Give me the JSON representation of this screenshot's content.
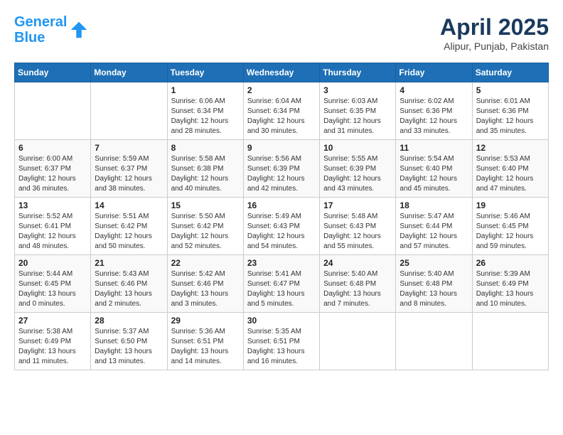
{
  "header": {
    "logo_line1": "General",
    "logo_line2": "Blue",
    "title": "April 2025",
    "subtitle": "Alipur, Punjab, Pakistan"
  },
  "weekdays": [
    "Sunday",
    "Monday",
    "Tuesday",
    "Wednesday",
    "Thursday",
    "Friday",
    "Saturday"
  ],
  "weeks": [
    [
      {
        "day": "",
        "info": ""
      },
      {
        "day": "",
        "info": ""
      },
      {
        "day": "1",
        "info": "Sunrise: 6:06 AM\nSunset: 6:34 PM\nDaylight: 12 hours\nand 28 minutes."
      },
      {
        "day": "2",
        "info": "Sunrise: 6:04 AM\nSunset: 6:34 PM\nDaylight: 12 hours\nand 30 minutes."
      },
      {
        "day": "3",
        "info": "Sunrise: 6:03 AM\nSunset: 6:35 PM\nDaylight: 12 hours\nand 31 minutes."
      },
      {
        "day": "4",
        "info": "Sunrise: 6:02 AM\nSunset: 6:36 PM\nDaylight: 12 hours\nand 33 minutes."
      },
      {
        "day": "5",
        "info": "Sunrise: 6:01 AM\nSunset: 6:36 PM\nDaylight: 12 hours\nand 35 minutes."
      }
    ],
    [
      {
        "day": "6",
        "info": "Sunrise: 6:00 AM\nSunset: 6:37 PM\nDaylight: 12 hours\nand 36 minutes."
      },
      {
        "day": "7",
        "info": "Sunrise: 5:59 AM\nSunset: 6:37 PM\nDaylight: 12 hours\nand 38 minutes."
      },
      {
        "day": "8",
        "info": "Sunrise: 5:58 AM\nSunset: 6:38 PM\nDaylight: 12 hours\nand 40 minutes."
      },
      {
        "day": "9",
        "info": "Sunrise: 5:56 AM\nSunset: 6:39 PM\nDaylight: 12 hours\nand 42 minutes."
      },
      {
        "day": "10",
        "info": "Sunrise: 5:55 AM\nSunset: 6:39 PM\nDaylight: 12 hours\nand 43 minutes."
      },
      {
        "day": "11",
        "info": "Sunrise: 5:54 AM\nSunset: 6:40 PM\nDaylight: 12 hours\nand 45 minutes."
      },
      {
        "day": "12",
        "info": "Sunrise: 5:53 AM\nSunset: 6:40 PM\nDaylight: 12 hours\nand 47 minutes."
      }
    ],
    [
      {
        "day": "13",
        "info": "Sunrise: 5:52 AM\nSunset: 6:41 PM\nDaylight: 12 hours\nand 48 minutes."
      },
      {
        "day": "14",
        "info": "Sunrise: 5:51 AM\nSunset: 6:42 PM\nDaylight: 12 hours\nand 50 minutes."
      },
      {
        "day": "15",
        "info": "Sunrise: 5:50 AM\nSunset: 6:42 PM\nDaylight: 12 hours\nand 52 minutes."
      },
      {
        "day": "16",
        "info": "Sunrise: 5:49 AM\nSunset: 6:43 PM\nDaylight: 12 hours\nand 54 minutes."
      },
      {
        "day": "17",
        "info": "Sunrise: 5:48 AM\nSunset: 6:43 PM\nDaylight: 12 hours\nand 55 minutes."
      },
      {
        "day": "18",
        "info": "Sunrise: 5:47 AM\nSunset: 6:44 PM\nDaylight: 12 hours\nand 57 minutes."
      },
      {
        "day": "19",
        "info": "Sunrise: 5:46 AM\nSunset: 6:45 PM\nDaylight: 12 hours\nand 59 minutes."
      }
    ],
    [
      {
        "day": "20",
        "info": "Sunrise: 5:44 AM\nSunset: 6:45 PM\nDaylight: 13 hours\nand 0 minutes."
      },
      {
        "day": "21",
        "info": "Sunrise: 5:43 AM\nSunset: 6:46 PM\nDaylight: 13 hours\nand 2 minutes."
      },
      {
        "day": "22",
        "info": "Sunrise: 5:42 AM\nSunset: 6:46 PM\nDaylight: 13 hours\nand 3 minutes."
      },
      {
        "day": "23",
        "info": "Sunrise: 5:41 AM\nSunset: 6:47 PM\nDaylight: 13 hours\nand 5 minutes."
      },
      {
        "day": "24",
        "info": "Sunrise: 5:40 AM\nSunset: 6:48 PM\nDaylight: 13 hours\nand 7 minutes."
      },
      {
        "day": "25",
        "info": "Sunrise: 5:40 AM\nSunset: 6:48 PM\nDaylight: 13 hours\nand 8 minutes."
      },
      {
        "day": "26",
        "info": "Sunrise: 5:39 AM\nSunset: 6:49 PM\nDaylight: 13 hours\nand 10 minutes."
      }
    ],
    [
      {
        "day": "27",
        "info": "Sunrise: 5:38 AM\nSunset: 6:49 PM\nDaylight: 13 hours\nand 11 minutes."
      },
      {
        "day": "28",
        "info": "Sunrise: 5:37 AM\nSunset: 6:50 PM\nDaylight: 13 hours\nand 13 minutes."
      },
      {
        "day": "29",
        "info": "Sunrise: 5:36 AM\nSunset: 6:51 PM\nDaylight: 13 hours\nand 14 minutes."
      },
      {
        "day": "30",
        "info": "Sunrise: 5:35 AM\nSunset: 6:51 PM\nDaylight: 13 hours\nand 16 minutes."
      },
      {
        "day": "",
        "info": ""
      },
      {
        "day": "",
        "info": ""
      },
      {
        "day": "",
        "info": ""
      }
    ]
  ]
}
